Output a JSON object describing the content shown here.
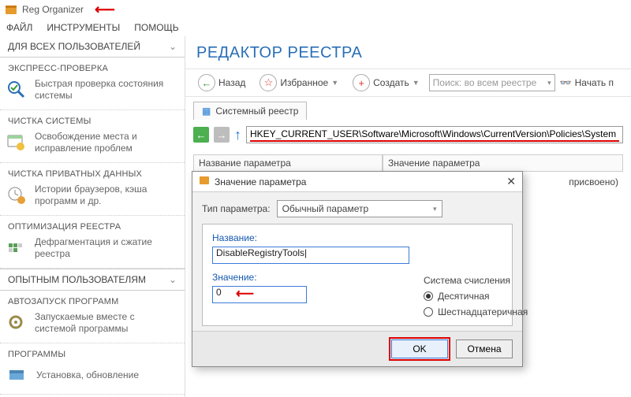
{
  "app": {
    "title": "Reg Organizer"
  },
  "menu": {
    "file": "ФАЙЛ",
    "tools": "ИНСТРУМЕНТЫ",
    "help": "ПОМОЩЬ"
  },
  "sidebar": {
    "header1": "ДЛЯ ВСЕХ ПОЛЬЗОВАТЕЛЕЙ",
    "header2": "ОПЫТНЫМ ПОЛЬЗОВАТЕЛЯМ",
    "sections": [
      {
        "title": "ЭКСПРЕСС-ПРОВЕРКА",
        "desc": "Быстрая проверка состояния системы"
      },
      {
        "title": "ЧИСТКА СИСТЕМЫ",
        "desc": "Освобождение места и исправление проблем"
      },
      {
        "title": "ЧИСТКА ПРИВАТНЫХ ДАННЫХ",
        "desc": "Истории браузеров, кэша программ и др."
      },
      {
        "title": "ОПТИМИЗАЦИЯ РЕЕСТРА",
        "desc": "Дефрагментация и сжатие реестра"
      },
      {
        "title": "АВТОЗАПУСК ПРОГРАММ",
        "desc": "Запускаемые вместе с системой программы"
      },
      {
        "title": "ПРОГРАММЫ",
        "desc": "Установка, обновление"
      }
    ]
  },
  "main": {
    "title": "РЕДАКТОР РЕЕСТРА",
    "toolbar": {
      "back": "Назад",
      "fav": "Избранное",
      "create": "Создать",
      "search_ph": "Поиск: во всем реестре",
      "start": "Начать п"
    },
    "tab": "Системный реестр",
    "path": "HKEY_CURRENT_USER\\Software\\Microsoft\\Windows\\CurrentVersion\\Policies\\System",
    "cols": {
      "name": "Название параметра",
      "value": "Значение параметра"
    },
    "row": {
      "value_suffix": "присвоено)"
    }
  },
  "dialog": {
    "title": "Значение параметра",
    "type_label": "Тип параметра:",
    "type_value": "Обычный параметр",
    "name_label": "Название:",
    "name_value": "DisableRegistryTools",
    "value_label": "Значение:",
    "value_value": "0",
    "ns_label": "Система счисления",
    "ns_dec": "Десятичная",
    "ns_hex": "Шестнадцатеричная",
    "ok": "OK",
    "cancel": "Отмена"
  }
}
